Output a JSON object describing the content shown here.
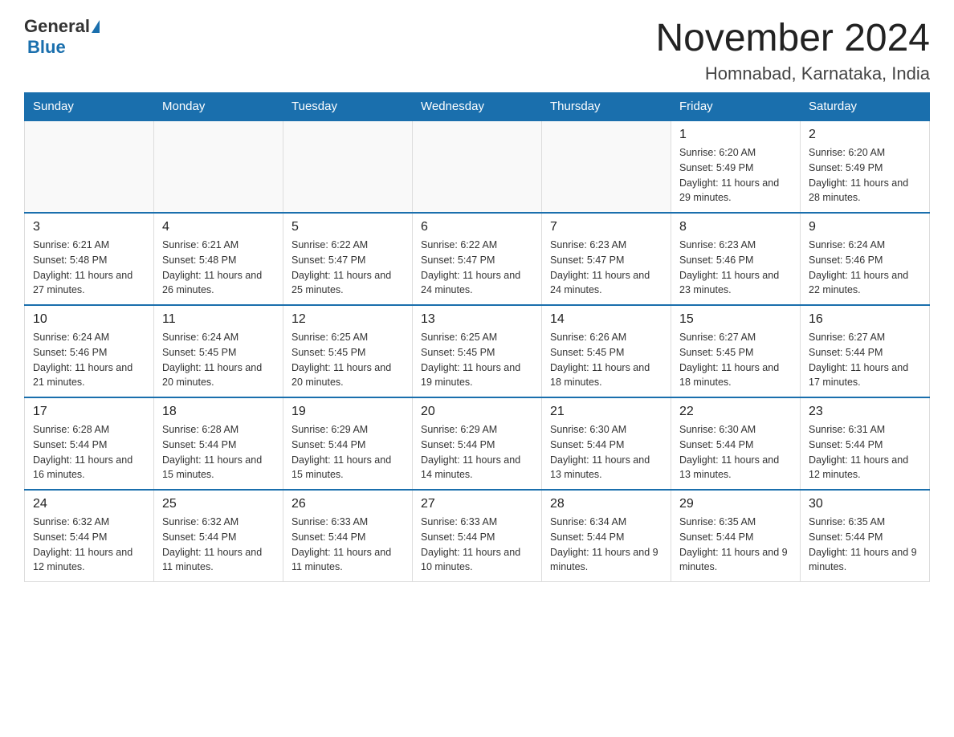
{
  "logo": {
    "general": "General",
    "blue": "Blue"
  },
  "header": {
    "month_year": "November 2024",
    "location": "Homnabad, Karnataka, India"
  },
  "weekdays": [
    "Sunday",
    "Monday",
    "Tuesday",
    "Wednesday",
    "Thursday",
    "Friday",
    "Saturday"
  ],
  "weeks": [
    [
      {
        "day": "",
        "info": ""
      },
      {
        "day": "",
        "info": ""
      },
      {
        "day": "",
        "info": ""
      },
      {
        "day": "",
        "info": ""
      },
      {
        "day": "",
        "info": ""
      },
      {
        "day": "1",
        "info": "Sunrise: 6:20 AM\nSunset: 5:49 PM\nDaylight: 11 hours and 29 minutes."
      },
      {
        "day": "2",
        "info": "Sunrise: 6:20 AM\nSunset: 5:49 PM\nDaylight: 11 hours and 28 minutes."
      }
    ],
    [
      {
        "day": "3",
        "info": "Sunrise: 6:21 AM\nSunset: 5:48 PM\nDaylight: 11 hours and 27 minutes."
      },
      {
        "day": "4",
        "info": "Sunrise: 6:21 AM\nSunset: 5:48 PM\nDaylight: 11 hours and 26 minutes."
      },
      {
        "day": "5",
        "info": "Sunrise: 6:22 AM\nSunset: 5:47 PM\nDaylight: 11 hours and 25 minutes."
      },
      {
        "day": "6",
        "info": "Sunrise: 6:22 AM\nSunset: 5:47 PM\nDaylight: 11 hours and 24 minutes."
      },
      {
        "day": "7",
        "info": "Sunrise: 6:23 AM\nSunset: 5:47 PM\nDaylight: 11 hours and 24 minutes."
      },
      {
        "day": "8",
        "info": "Sunrise: 6:23 AM\nSunset: 5:46 PM\nDaylight: 11 hours and 23 minutes."
      },
      {
        "day": "9",
        "info": "Sunrise: 6:24 AM\nSunset: 5:46 PM\nDaylight: 11 hours and 22 minutes."
      }
    ],
    [
      {
        "day": "10",
        "info": "Sunrise: 6:24 AM\nSunset: 5:46 PM\nDaylight: 11 hours and 21 minutes."
      },
      {
        "day": "11",
        "info": "Sunrise: 6:24 AM\nSunset: 5:45 PM\nDaylight: 11 hours and 20 minutes."
      },
      {
        "day": "12",
        "info": "Sunrise: 6:25 AM\nSunset: 5:45 PM\nDaylight: 11 hours and 20 minutes."
      },
      {
        "day": "13",
        "info": "Sunrise: 6:25 AM\nSunset: 5:45 PM\nDaylight: 11 hours and 19 minutes."
      },
      {
        "day": "14",
        "info": "Sunrise: 6:26 AM\nSunset: 5:45 PM\nDaylight: 11 hours and 18 minutes."
      },
      {
        "day": "15",
        "info": "Sunrise: 6:27 AM\nSunset: 5:45 PM\nDaylight: 11 hours and 18 minutes."
      },
      {
        "day": "16",
        "info": "Sunrise: 6:27 AM\nSunset: 5:44 PM\nDaylight: 11 hours and 17 minutes."
      }
    ],
    [
      {
        "day": "17",
        "info": "Sunrise: 6:28 AM\nSunset: 5:44 PM\nDaylight: 11 hours and 16 minutes."
      },
      {
        "day": "18",
        "info": "Sunrise: 6:28 AM\nSunset: 5:44 PM\nDaylight: 11 hours and 15 minutes."
      },
      {
        "day": "19",
        "info": "Sunrise: 6:29 AM\nSunset: 5:44 PM\nDaylight: 11 hours and 15 minutes."
      },
      {
        "day": "20",
        "info": "Sunrise: 6:29 AM\nSunset: 5:44 PM\nDaylight: 11 hours and 14 minutes."
      },
      {
        "day": "21",
        "info": "Sunrise: 6:30 AM\nSunset: 5:44 PM\nDaylight: 11 hours and 13 minutes."
      },
      {
        "day": "22",
        "info": "Sunrise: 6:30 AM\nSunset: 5:44 PM\nDaylight: 11 hours and 13 minutes."
      },
      {
        "day": "23",
        "info": "Sunrise: 6:31 AM\nSunset: 5:44 PM\nDaylight: 11 hours and 12 minutes."
      }
    ],
    [
      {
        "day": "24",
        "info": "Sunrise: 6:32 AM\nSunset: 5:44 PM\nDaylight: 11 hours and 12 minutes."
      },
      {
        "day": "25",
        "info": "Sunrise: 6:32 AM\nSunset: 5:44 PM\nDaylight: 11 hours and 11 minutes."
      },
      {
        "day": "26",
        "info": "Sunrise: 6:33 AM\nSunset: 5:44 PM\nDaylight: 11 hours and 11 minutes."
      },
      {
        "day": "27",
        "info": "Sunrise: 6:33 AM\nSunset: 5:44 PM\nDaylight: 11 hours and 10 minutes."
      },
      {
        "day": "28",
        "info": "Sunrise: 6:34 AM\nSunset: 5:44 PM\nDaylight: 11 hours and 9 minutes."
      },
      {
        "day": "29",
        "info": "Sunrise: 6:35 AM\nSunset: 5:44 PM\nDaylight: 11 hours and 9 minutes."
      },
      {
        "day": "30",
        "info": "Sunrise: 6:35 AM\nSunset: 5:44 PM\nDaylight: 11 hours and 9 minutes."
      }
    ]
  ]
}
